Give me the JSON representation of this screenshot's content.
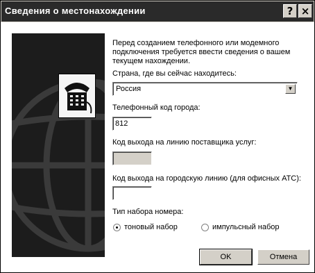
{
  "window": {
    "title": "Сведения о местонахождении",
    "help_glyph": "?",
    "close_glyph": "×"
  },
  "intro_text": "Перед созданием телефонного или модемного подключения требуется ввести сведения о вашем текущем нахождении.",
  "country": {
    "label": "Страна, где вы сейчас находитесь:",
    "value": "Россия"
  },
  "area_code": {
    "label": "Телефонный код города:",
    "value": "812"
  },
  "carrier_code": {
    "label": "Код выхода на линию поставщика услуг:",
    "value": ""
  },
  "outside_line": {
    "label": "Код выхода на городскую линию (для офисных АТС):",
    "value": ""
  },
  "dialing": {
    "label": "Тип набора номера:",
    "tone": "тоновый набор",
    "pulse": "импульсный набор",
    "selected": "tone"
  },
  "buttons": {
    "ok": "OK",
    "cancel": "Отмена"
  }
}
